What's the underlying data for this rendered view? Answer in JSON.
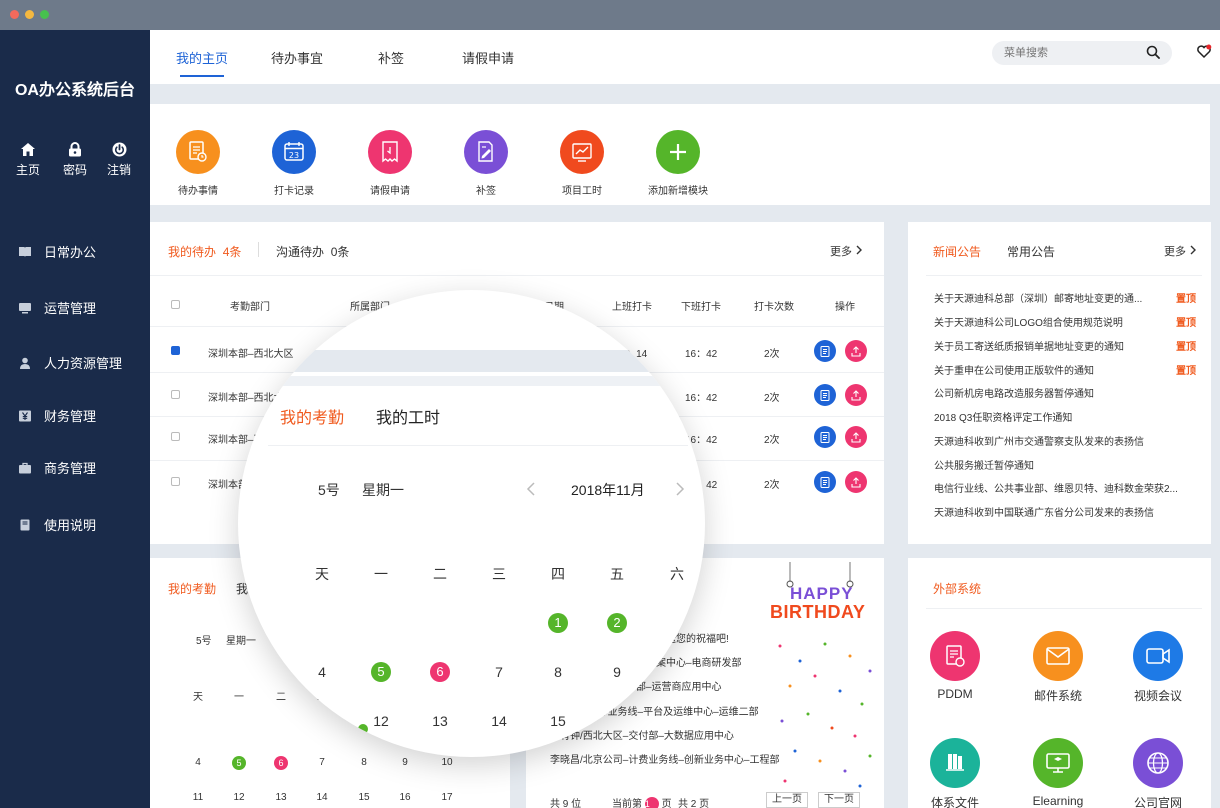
{
  "app": {
    "title": "OA办公系统后台"
  },
  "colors": {
    "accent": "#1e63d6",
    "orange": "#f05a1e",
    "sidebar": "#1a2b4a",
    "green": "#55b52a",
    "pink": "#ee3570"
  },
  "quick": [
    {
      "label": "主页",
      "icon": "home-icon"
    },
    {
      "label": "密码",
      "icon": "lock-icon"
    },
    {
      "label": "注销",
      "icon": "power-icon"
    }
  ],
  "menu": [
    {
      "label": "日常办公",
      "icon": "book-icon"
    },
    {
      "label": "运营管理",
      "icon": "monitor-icon"
    },
    {
      "label": "人力资源管理",
      "icon": "person-icon"
    },
    {
      "label": "财务管理",
      "icon": "yen-icon"
    },
    {
      "label": "商务管理",
      "icon": "briefcase-icon"
    },
    {
      "label": "使用说明",
      "icon": "manual-icon"
    }
  ],
  "topnav": {
    "tabs": [
      "我的主页",
      "待办事宜",
      "补签",
      "请假申请"
    ],
    "search_placeholder": "菜单搜索"
  },
  "modules": [
    {
      "label": "待办事情",
      "color": "#f7901e",
      "icon": "todo-icon"
    },
    {
      "label": "打卡记录",
      "color": "#1e63d6",
      "icon": "calendar-icon"
    },
    {
      "label": "请假申请",
      "color": "#ee3570",
      "icon": "leave-icon"
    },
    {
      "label": "补签",
      "color": "#7a4fd6",
      "icon": "edit-icon"
    },
    {
      "label": "项目工时",
      "color": "#f04a1e",
      "icon": "chart-icon"
    },
    {
      "label": "添加新增模块",
      "color": "#55b52a",
      "icon": "plus-icon"
    }
  ],
  "todo": {
    "tab1": "我的待办",
    "tab1_count": "4条",
    "tab2": "沟通待办",
    "tab2_count": "0条",
    "more": "更多",
    "headers": [
      "考勤部门",
      "所属部门",
      "日期",
      "上班打卡",
      "下班打卡",
      "打卡次数",
      "操作"
    ],
    "rows": [
      {
        "dept": "深圳本部–西北大区",
        "sub": "交",
        "in": "08：14",
        "out": "16：42",
        "times": "2次"
      },
      {
        "dept": "深圳本部–西北大区",
        "sub": "",
        "in": "",
        "out": "16：42",
        "times": "2次"
      },
      {
        "dept": "深圳本部–西",
        "sub": "",
        "in": "",
        "out": "16：42",
        "times": "2次"
      },
      {
        "dept": "深圳本部–",
        "sub": "",
        "in": "",
        "out": "16：42",
        "times": "2次"
      }
    ]
  },
  "news": {
    "tab1": "新闻公告",
    "tab2": "常用公告",
    "more": "更多",
    "tag": "置顶",
    "items": [
      "关于天源迪科总部（深圳）邮寄地址变更的通...",
      "关于天源迪科公司LOGO组合使用规范说明",
      "关于员工寄送纸质报销单据地址变更的通知",
      "关于重申在公司使用正版软件的通知",
      "公司新机房电路改造服务器暂停通知",
      "2018 Q3任职资格评定工作通知",
      "天源迪科收到广州市交通警察支队发来的表扬信",
      "公共服务搬迁暂停通知",
      "电信行业线、公共事业部、维恩贝特、迪科数金荣获2...",
      "天源迪科收到中国联通广东省分公司发来的表扬信"
    ]
  },
  "attendance": {
    "tab1": "我的考勤",
    "tab2": "我的工时",
    "day": "5号",
    "weekday": "星期一",
    "month": "2018年11月",
    "weekdays": [
      "天",
      "一",
      "二",
      "三",
      "四",
      "五",
      "六"
    ],
    "row1": [
      "",
      "",
      "",
      "",
      "1",
      "2",
      ""
    ],
    "row2": [
      "4",
      "5",
      "6",
      "7",
      "8",
      "9",
      "10"
    ],
    "row3": [
      "11",
      "12",
      "13",
      "14",
      "15",
      "16",
      "17"
    ]
  },
  "birthday": {
    "line1": "HAPPY",
    "line2": "BIRTHDAY",
    "messages": [
      "们发送您的祝福吧!",
      "方案中心–电商研发部",
      "交付部–运营商应用中心",
      "公司–总部业务线–平台及运维中心–运维二部",
      "土有钟/西北大区–交付部–大数据应用中心",
      "李晓昌/北京公司–计费业务线–创新业务中心–工程部"
    ],
    "total_prefix": "共",
    "total": "9",
    "total_suffix": "位",
    "page_prefix": "当前第",
    "page": "1",
    "page_suffix": "页",
    "pages_prefix": "共",
    "pages": "2",
    "pages_suffix": "页",
    "prev": "上一页",
    "next": "下一页"
  },
  "external": {
    "title": "外部系统",
    "items": [
      {
        "label": "PDDM",
        "color": "#ee3570",
        "icon": "pddm-icon"
      },
      {
        "label": "邮件系统",
        "color": "#f7901e",
        "icon": "mail-icon"
      },
      {
        "label": "视频会议",
        "color": "#1e7ae6",
        "icon": "video-icon"
      },
      {
        "label": "体系文件",
        "color": "#1bb39a",
        "icon": "files-icon"
      },
      {
        "label": "Elearning",
        "color": "#55b52a",
        "icon": "elearning-icon"
      },
      {
        "label": "公司官网",
        "color": "#7a4fd6",
        "icon": "globe-icon"
      }
    ]
  }
}
